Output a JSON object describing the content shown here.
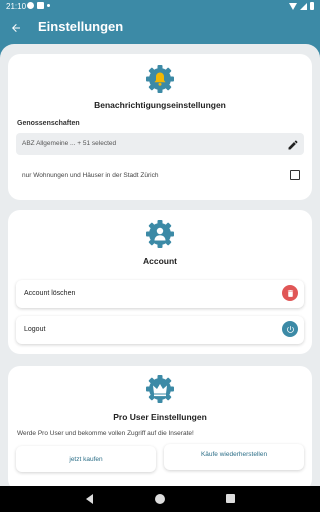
{
  "status_bar": {
    "time": "21:10"
  },
  "app_bar": {
    "title": "Einstellungen"
  },
  "notifications": {
    "heading": "Benachrichtigungseinstellungen",
    "coop_label": "Genossenschaften",
    "coop_value": "ABZ Allgemeine ... + 51 selected",
    "checkbox_label": "nur Wohnungen und Häuser in der Stadt Zürich",
    "checkbox_checked": false
  },
  "account": {
    "heading": "Account",
    "delete_label": "Account löschen",
    "logout_label": "Logout"
  },
  "pro": {
    "heading": "Pro User Einstellungen",
    "description": "Werde Pro User und bekomme vollen Zugriff auf die Inserate!",
    "buy_label": "jetzt kaufen",
    "restore_label": "Käufe wiederherstellen"
  },
  "colors": {
    "primary": "#3c8aa6",
    "danger": "#e05656",
    "background": "#e9ecee"
  },
  "icons": {
    "notify": "bell-gear-icon",
    "account": "user-gear-icon",
    "pro": "crown-gear-icon",
    "edit": "pencil-icon",
    "delete": "trash-icon",
    "logout": "power-icon"
  }
}
